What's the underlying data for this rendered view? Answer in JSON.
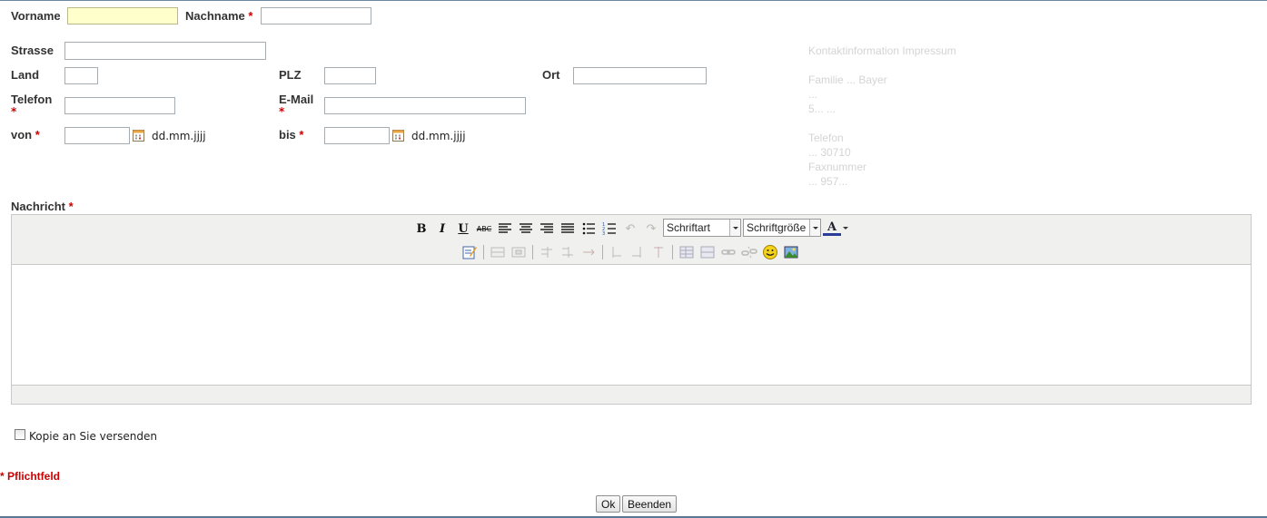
{
  "form": {
    "vorname_label": "Vorname",
    "nachname_label": "Nachname",
    "strasse_label": "Strasse",
    "land_label": "Land",
    "plz_label": "PLZ",
    "ort_label": "Ort",
    "telefon_label": "Telefon",
    "email_label": "E-Mail",
    "von_label": "von",
    "bis_label": "bis",
    "date_hint": "dd.mm.jjjj",
    "nachricht_label": "Nachricht",
    "required_mark": "*",
    "copy_label": "Kopie an Sie versenden",
    "pflichtfeld_note": "* Pflichtfeld",
    "values": {
      "vorname": "",
      "nachname": "",
      "strasse": "",
      "land": "",
      "plz": "",
      "ort": "",
      "telefon": "",
      "email": "",
      "von": "",
      "bis": ""
    }
  },
  "editor": {
    "toolbar_row1": [
      "bold",
      "italic",
      "underline",
      "strikethrough",
      "align-left",
      "align-center",
      "align-right",
      "align-justify",
      "bullet-list",
      "numbered-list",
      "undo",
      "redo"
    ],
    "font_select": "Schriftart",
    "size_select": "Schriftgröße",
    "toolbar_row2": [
      "edit-html",
      "table",
      "table-cell",
      "row-before",
      "row-after",
      "row-delete",
      "col-before",
      "col-after",
      "col-delete",
      "table-props",
      "table-merge",
      "link",
      "unlink",
      "emoticon",
      "insert-image"
    ]
  },
  "contact_panel": {
    "heading": "Kontaktinformation Impressum",
    "line1": "Familie ... Bayer",
    "line2": "...",
    "line3": "5... ...",
    "line4": "Telefon",
    "line5": "... 30710",
    "line6": "Faxnummer",
    "line7": "... 957..."
  },
  "buttons": {
    "ok": "Ok",
    "cancel": "Beenden"
  },
  "colors": {
    "required": "#cc0000",
    "focus_bg": "#ffffcc",
    "toolbar_bg": "#f0f0ee"
  }
}
